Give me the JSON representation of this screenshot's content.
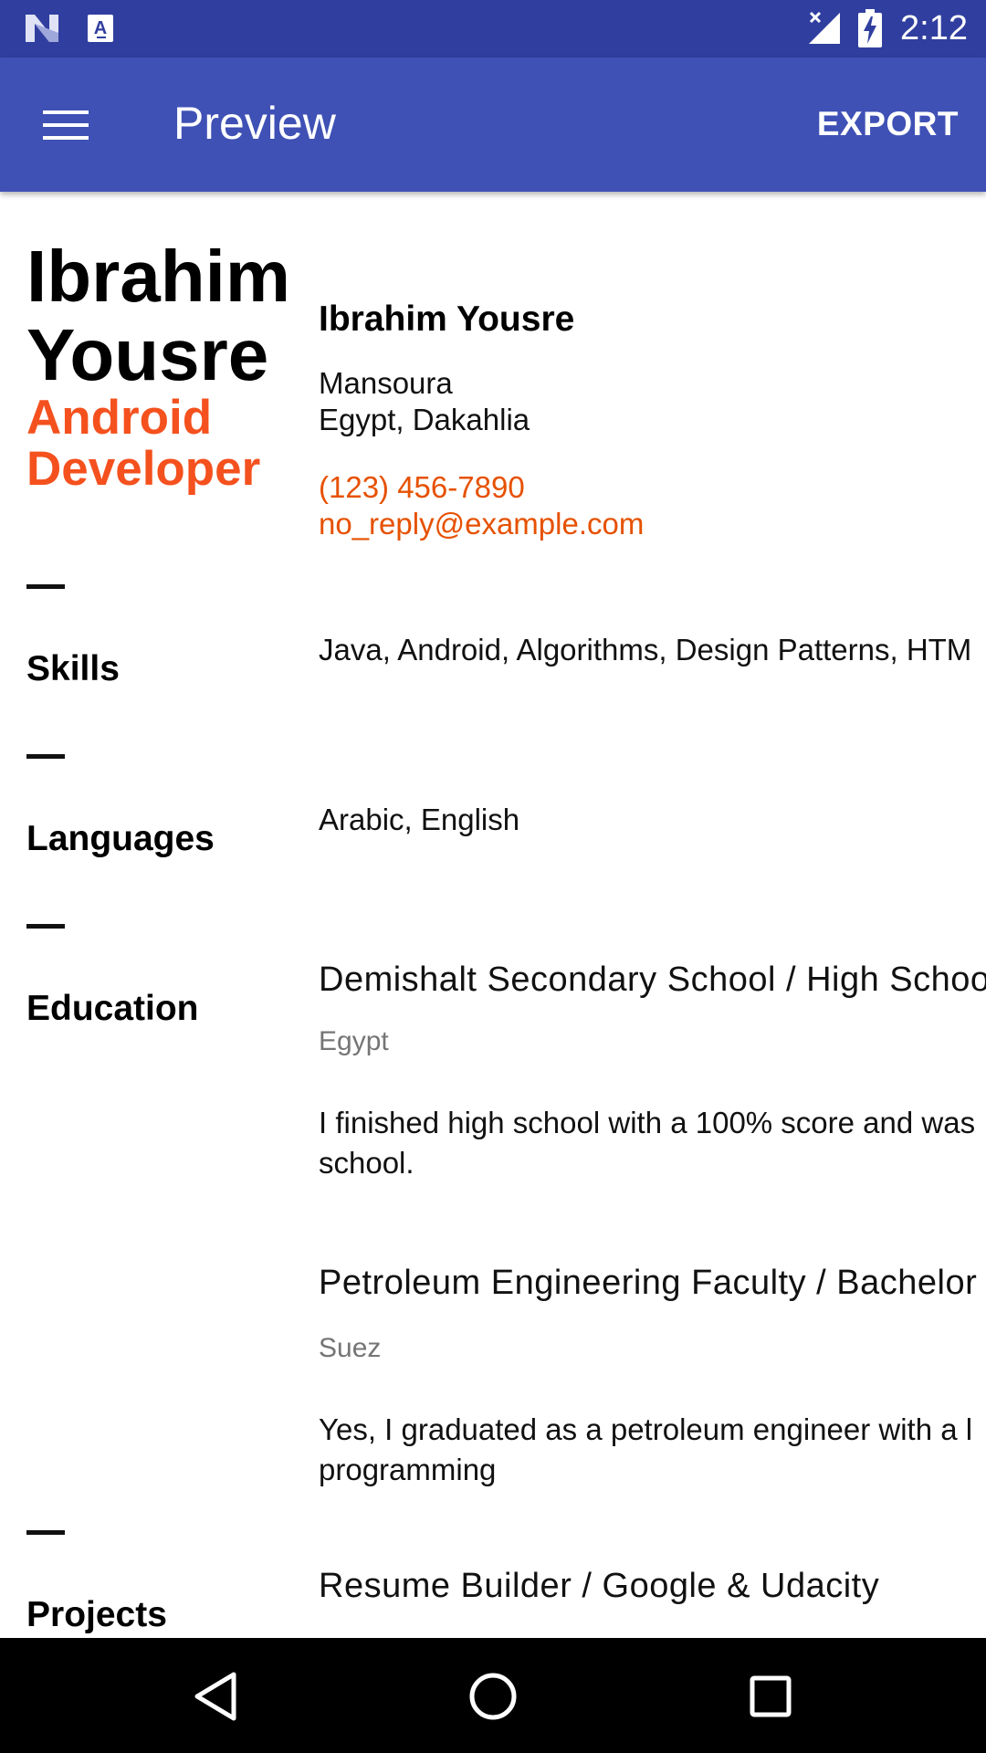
{
  "status_bar": {
    "time": "2:12",
    "icons": [
      "n-logo-icon",
      "a-notification-icon",
      "signal-icon",
      "battery-charging-icon"
    ]
  },
  "app_bar": {
    "menu_icon": "hamburger-menu-icon",
    "title": "Preview",
    "export_label": "EXPORT"
  },
  "resume": {
    "name_line1": "Ibrahim",
    "name_line2": "Yousre",
    "role_line1": "Android",
    "role_line2": "Developer",
    "contact": {
      "name": "Ibrahim Yousre",
      "city": "Mansoura",
      "region": "Egypt, Dakahlia",
      "phone": "(123) 456-7890",
      "email": "no_reply@example.com"
    },
    "sections": {
      "skills": {
        "title": "Skills",
        "text": "Java, Android, Algorithms, Design Patterns, HTM"
      },
      "languages": {
        "title": "Languages",
        "text": "Arabic, English"
      },
      "education": {
        "title": "Education",
        "entries": [
          {
            "heading": "Demishalt Secondary School / High Schoo",
            "location": "Egypt",
            "desc_line1": "I finished high school with a 100% score and was",
            "desc_line2": "school."
          },
          {
            "heading": "Petroleum Engineering Faculty / Bachelor",
            "location": "Suez",
            "desc_line1": "Yes, I graduated as a petroleum engineer with a l",
            "desc_line2": "programming"
          }
        ]
      },
      "projects": {
        "title": "Projects",
        "heading": "Resume Builder / Google & Udacity"
      }
    }
  },
  "nav_bar": {
    "icons": [
      "back-icon",
      "home-icon",
      "recents-icon"
    ]
  },
  "colors": {
    "status_bar": "#303f9f",
    "app_bar": "#3f51b5",
    "accent_orange": "#f4511e",
    "contact_orange": "#e65100"
  }
}
